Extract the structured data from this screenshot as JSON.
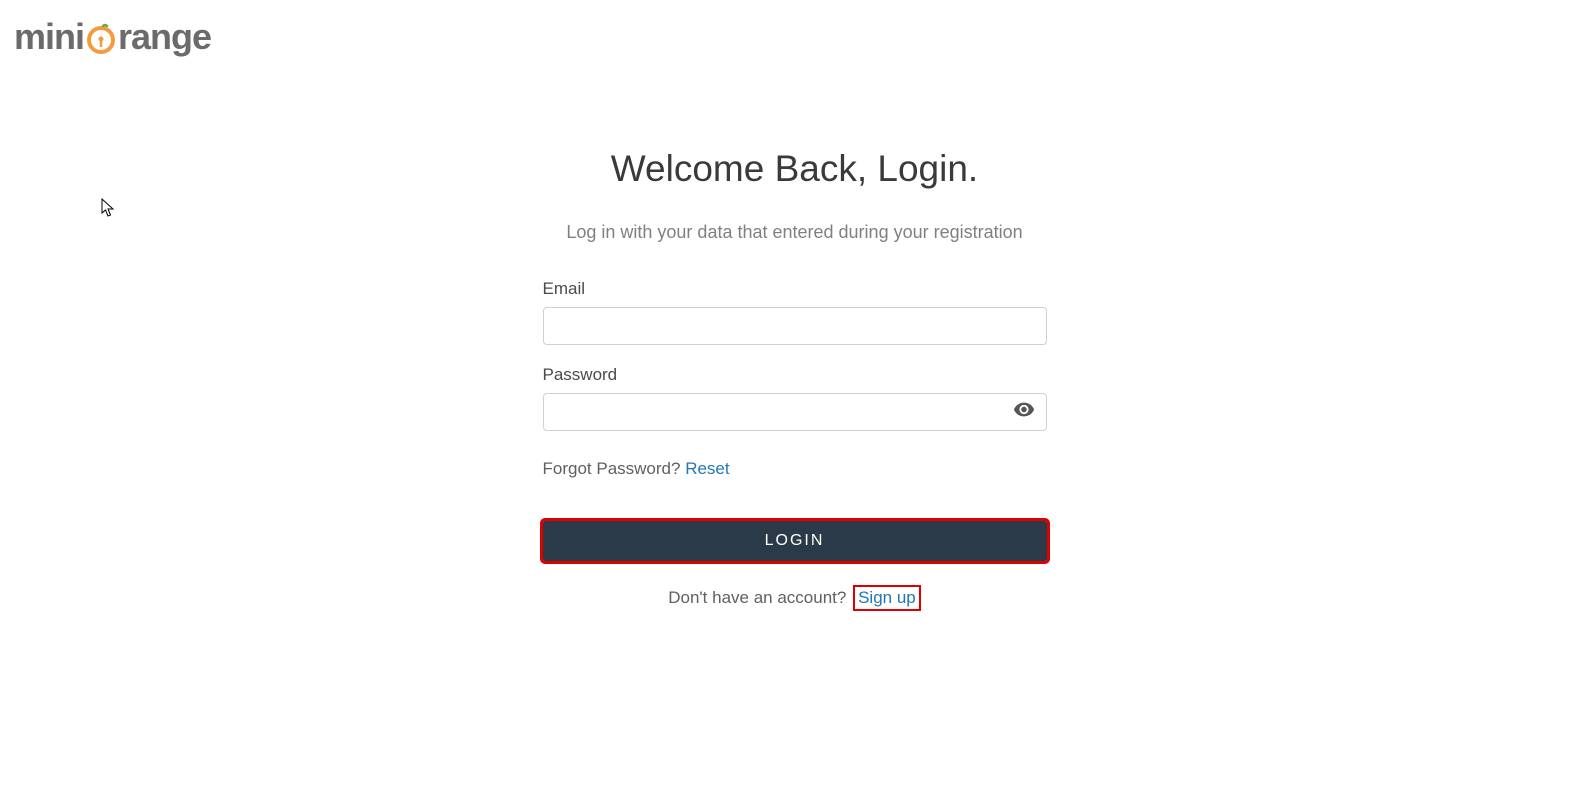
{
  "logo": {
    "text_before": "mini",
    "text_after": "range"
  },
  "heading": "Welcome Back, Login.",
  "subheading": "Log in with your data that entered during your registration",
  "form": {
    "email_label": "Email",
    "email_value": "",
    "password_label": "Password",
    "password_value": ""
  },
  "forgot": {
    "text": "Forgot Password? ",
    "link": "Reset"
  },
  "login_button": "LOGIN",
  "signup": {
    "text": "Don't have an account? ",
    "link": "Sign up"
  }
}
